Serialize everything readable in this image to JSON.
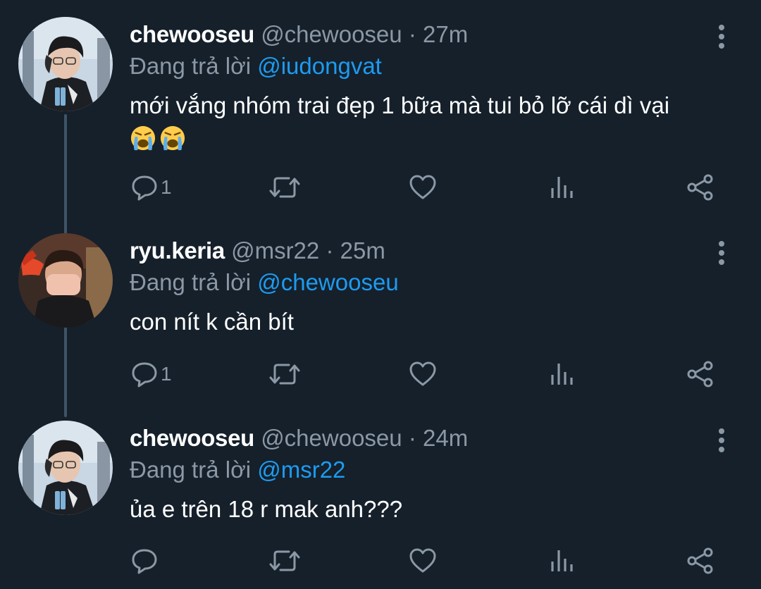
{
  "colors": {
    "background": "#15202b",
    "text_primary": "#ffffff",
    "text_secondary": "#8b98a5",
    "accent": "#1d9bf0",
    "thread_line": "#3d5466"
  },
  "tweets": [
    {
      "name": "chewooseu",
      "handle": "@chewooseu",
      "separator": "·",
      "time": "27m",
      "reply_prefix": "Đang trả lời",
      "reply_to": "@iudongvat",
      "text": "mới vắng nhóm trai đẹp 1 bữa mà tui bỏ lỡ cái dì vại",
      "emojis": [
        "loudly-crying-face",
        "loudly-crying-face"
      ],
      "reply_count": "1",
      "avatar": "chewooseu-avatar"
    },
    {
      "name": "ryu.keria",
      "handle": "@msr22",
      "separator": "·",
      "time": "25m",
      "reply_prefix": "Đang trả lời",
      "reply_to": "@chewooseu",
      "text": "con nít k cần bít",
      "emojis": [],
      "reply_count": "1",
      "avatar": "keria-avatar"
    },
    {
      "name": "chewooseu",
      "handle": "@chewooseu",
      "separator": "·",
      "time": "24m",
      "reply_prefix": "Đang trả lời",
      "reply_to": "@msr22",
      "text": "ủa e trên 18 r mak anh???",
      "emojis": [],
      "reply_count": "",
      "avatar": "chewooseu-avatar"
    }
  ],
  "icons": {
    "reply": "reply-icon",
    "retweet": "retweet-icon",
    "like": "like-icon",
    "analytics": "analytics-icon",
    "share": "share-icon",
    "more": "more-options-icon"
  }
}
